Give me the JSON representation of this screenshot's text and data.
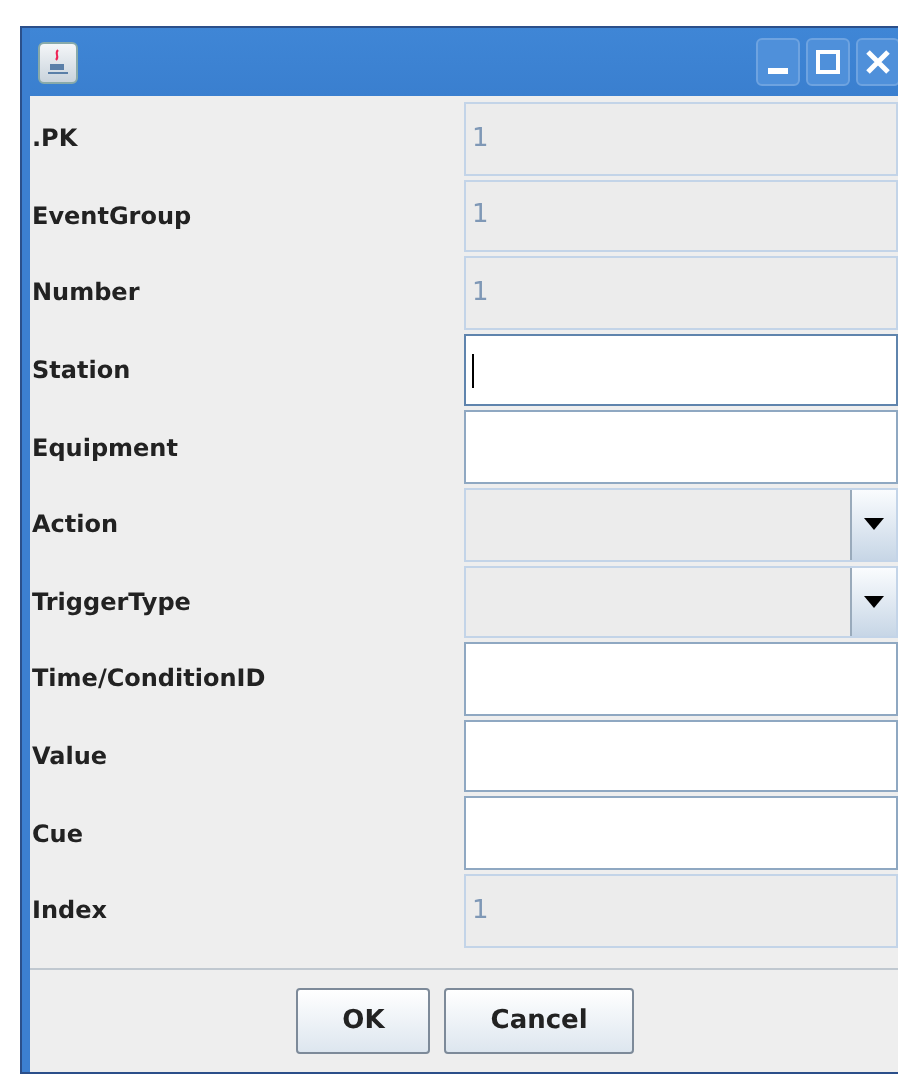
{
  "fields": [
    {
      "label": ".PK",
      "kind": "text",
      "value": "1",
      "disabled": true,
      "focused": false
    },
    {
      "label": "EventGroup",
      "kind": "text",
      "value": "1",
      "disabled": true,
      "focused": false
    },
    {
      "label": "Number",
      "kind": "text",
      "value": "1",
      "disabled": true,
      "focused": false
    },
    {
      "label": "Station",
      "kind": "text",
      "disabled": false,
      "focused": true
    },
    {
      "label": "Equipment",
      "kind": "text",
      "disabled": false,
      "focused": false
    },
    {
      "label": "Action",
      "kind": "combo",
      "disabled": true
    },
    {
      "label": "TriggerType",
      "kind": "combo",
      "disabled": true
    },
    {
      "label": "Time/ConditionID",
      "kind": "text",
      "disabled": false,
      "focused": false
    },
    {
      "label": "Value",
      "kind": "text",
      "disabled": false,
      "focused": false
    },
    {
      "label": "Cue",
      "kind": "text",
      "disabled": false,
      "focused": false
    },
    {
      "label": "Index",
      "kind": "text",
      "value": "1",
      "disabled": true,
      "focused": false
    }
  ],
  "buttons": [
    "OK",
    "Cancel"
  ]
}
